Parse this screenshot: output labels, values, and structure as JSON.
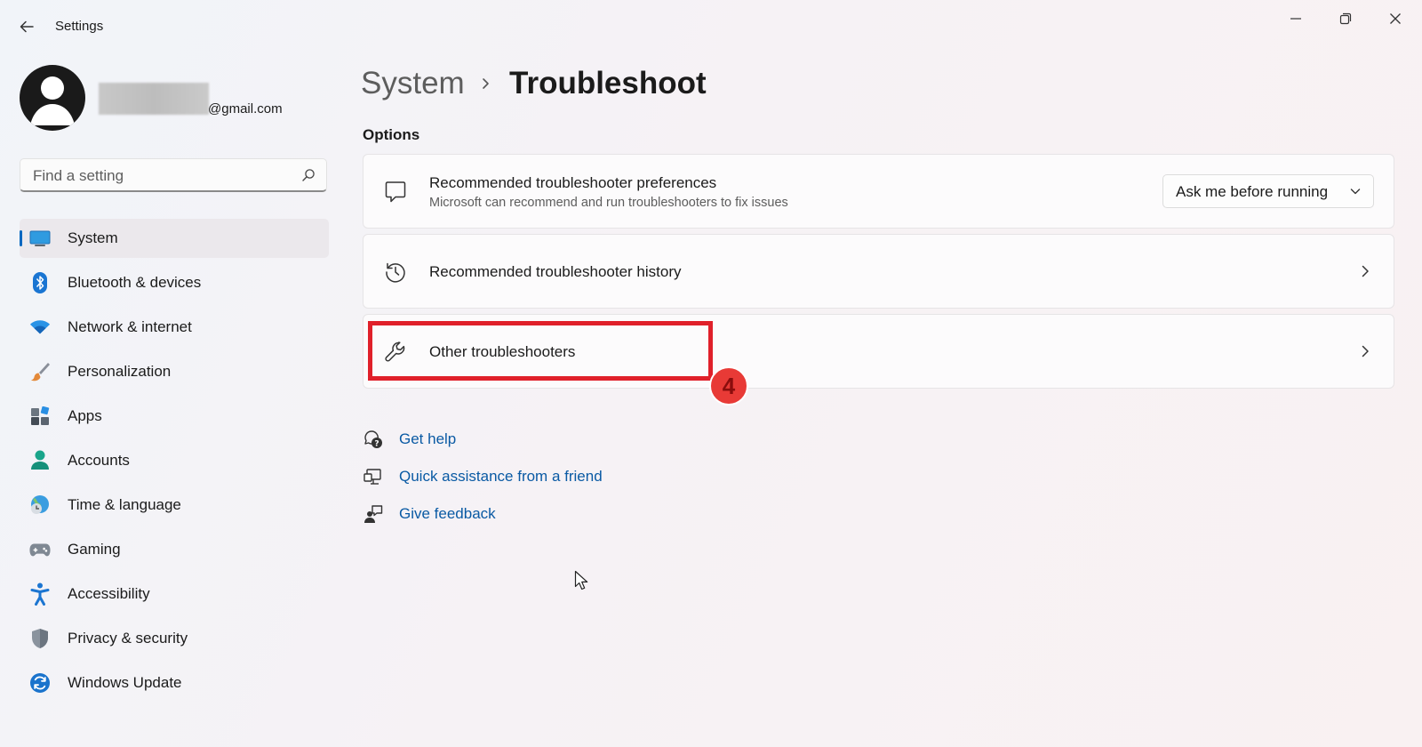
{
  "window": {
    "title": "Settings",
    "icons": {
      "back": "back-arrow-icon",
      "minimize": "minimize-icon",
      "maximize": "restore-icon",
      "close": "close-icon"
    }
  },
  "profile": {
    "email_suffix": "@gmail.com"
  },
  "search": {
    "placeholder": "Find a setting",
    "value": ""
  },
  "sidebar": {
    "items": [
      {
        "label": "System",
        "icon": "system-monitor-icon",
        "active": true
      },
      {
        "label": "Bluetooth & devices",
        "icon": "bluetooth-icon",
        "active": false
      },
      {
        "label": "Network & internet",
        "icon": "wifi-icon",
        "active": false
      },
      {
        "label": "Personalization",
        "icon": "paintbrush-icon",
        "active": false
      },
      {
        "label": "Apps",
        "icon": "apps-icon",
        "active": false
      },
      {
        "label": "Accounts",
        "icon": "accounts-icon",
        "active": false
      },
      {
        "label": "Time & language",
        "icon": "globe-clock-icon",
        "active": false
      },
      {
        "label": "Gaming",
        "icon": "gamepad-icon",
        "active": false
      },
      {
        "label": "Accessibility",
        "icon": "accessibility-icon",
        "active": false
      },
      {
        "label": "Privacy & security",
        "icon": "shield-icon",
        "active": false
      },
      {
        "label": "Windows Update",
        "icon": "windows-update-icon",
        "active": false
      }
    ]
  },
  "breadcrumb": {
    "parent": "System",
    "current": "Troubleshoot"
  },
  "options": {
    "label": "Options",
    "cards": [
      {
        "title": "Recommended troubleshooter preferences",
        "subtitle": "Microsoft can recommend and run troubleshooters to fix issues",
        "icon": "chat-bubble-icon",
        "dropdown_value": "Ask me before running"
      },
      {
        "title": "Recommended troubleshooter history",
        "icon": "history-icon"
      },
      {
        "title": "Other troubleshooters",
        "icon": "wrench-icon"
      }
    ]
  },
  "annotation": {
    "step": "4",
    "color": "#e0202a"
  },
  "links": [
    {
      "label": "Get help",
      "icon": "get-help-icon"
    },
    {
      "label": "Quick assistance from a friend",
      "icon": "quick-assist-icon"
    },
    {
      "label": "Give feedback",
      "icon": "feedback-icon"
    }
  ],
  "colors": {
    "accent": "#0067c0",
    "link": "#0a5aa4",
    "annotation": "#e0202a"
  }
}
